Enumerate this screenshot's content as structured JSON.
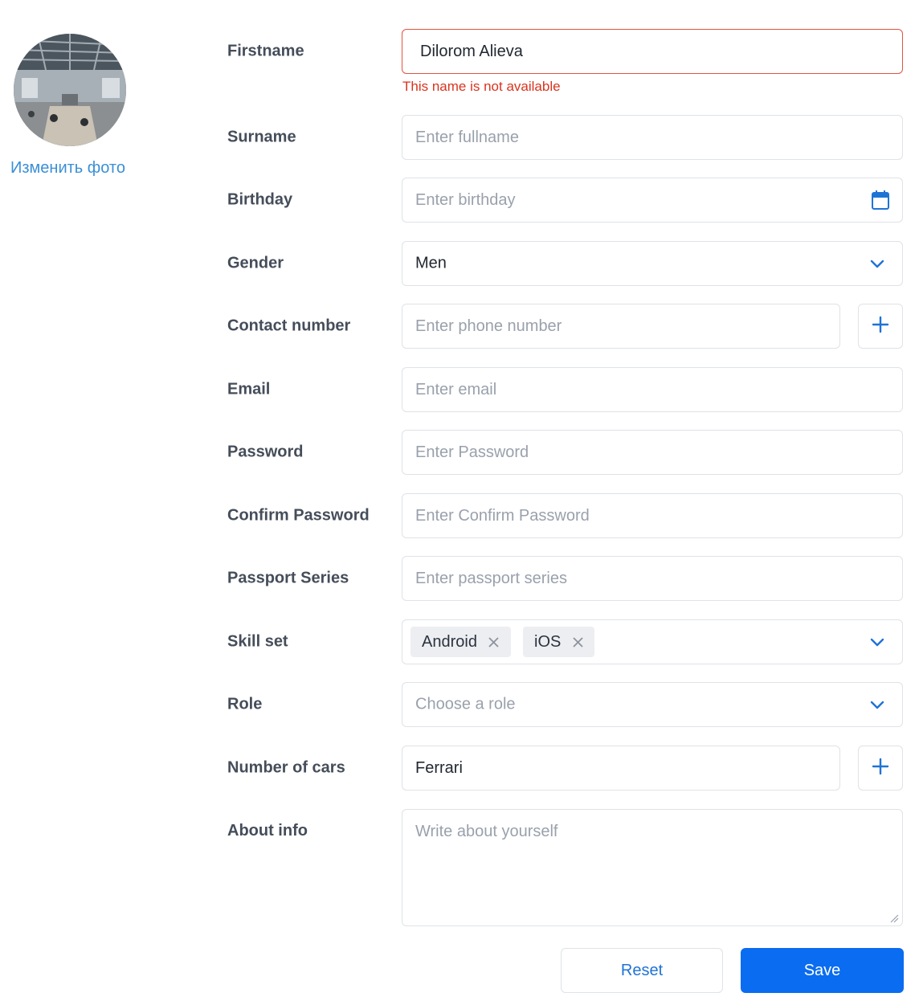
{
  "profile": {
    "change_photo_label": "Изменить фото"
  },
  "form": {
    "firstname": {
      "label": "Firstname",
      "value": "Dilorom Alieva",
      "error": "This name is not available"
    },
    "surname": {
      "label": "Surname",
      "placeholder": "Enter fullname"
    },
    "birthday": {
      "label": "Birthday",
      "placeholder": "Enter birthday",
      "icon": "calendar-icon"
    },
    "gender": {
      "label": "Gender",
      "selected": "Men",
      "icon": "chevron-down-icon"
    },
    "contact_number": {
      "label": "Contact number",
      "placeholder": "Enter phone number",
      "add_icon": "plus-icon"
    },
    "email": {
      "label": "Email",
      "placeholder": "Enter email"
    },
    "password": {
      "label": "Password",
      "placeholder": "Enter Password"
    },
    "confirm_password": {
      "label": "Confirm Password",
      "placeholder": "Enter Confirm Password"
    },
    "passport_series": {
      "label": "Passport Series",
      "placeholder": "Enter passport series"
    },
    "skill_set": {
      "label": "Skill set",
      "chips": [
        "Android",
        "iOS"
      ],
      "icon": "chevron-down-icon"
    },
    "role": {
      "label": "Role",
      "placeholder": "Choose a role",
      "icon": "chevron-down-icon"
    },
    "number_of_cars": {
      "label": "Number of cars",
      "value": "Ferrari",
      "add_icon": "plus-icon"
    },
    "about_info": {
      "label": "About info",
      "placeholder": "Write about yourself"
    }
  },
  "actions": {
    "reset_label": "Reset",
    "save_label": "Save"
  },
  "colors": {
    "accent": "#0a6cf0",
    "link": "#3a8fd6",
    "error": "#d9341f",
    "icon_blue": "#1f73d6"
  }
}
